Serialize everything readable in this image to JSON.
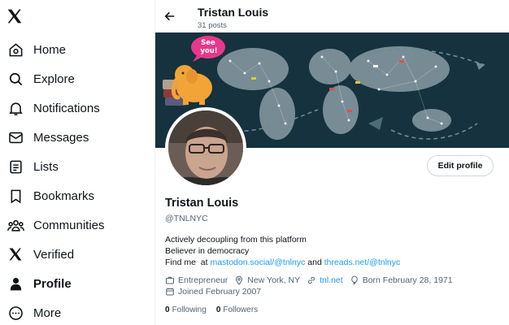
{
  "nav": {
    "logo_icon": "x-logo-icon",
    "items": [
      {
        "label": "Home",
        "icon": "home-icon"
      },
      {
        "label": "Explore",
        "icon": "search-icon"
      },
      {
        "label": "Notifications",
        "icon": "bell-icon"
      },
      {
        "label": "Messages",
        "icon": "envelope-icon"
      },
      {
        "label": "Lists",
        "icon": "list-icon"
      },
      {
        "label": "Bookmarks",
        "icon": "bookmark-icon"
      },
      {
        "label": "Communities",
        "icon": "communities-icon"
      },
      {
        "label": "Verified",
        "icon": "x-logo-icon"
      },
      {
        "label": "Profile",
        "icon": "person-icon",
        "active": true
      },
      {
        "label": "More",
        "icon": "more-circle-icon"
      }
    ]
  },
  "header": {
    "name": "Tristan Louis",
    "posts": "31 posts"
  },
  "banner": {
    "sticker_text_1": "See",
    "sticker_text_2": "you!"
  },
  "profile": {
    "edit_label": "Edit profile",
    "name": "Tristan Louis",
    "handle": "@TNLNYC",
    "bio_line1": "Actively decoupling from this platform",
    "bio_line2": "Believer in democracy",
    "bio_line3_prefix": "Find me  at ",
    "bio_link1": "mastodon.social/@tnlnyc",
    "bio_and": " and ",
    "bio_link2": "threads.net/@tnlnyc",
    "category": "Entrepreneur",
    "location": "New York, NY",
    "website": "tnl.net",
    "born": "Born February 28, 1971",
    "joined": "Joined February 2007",
    "following_count": "0",
    "following_label": "Following",
    "followers_count": "0",
    "followers_label": "Followers"
  },
  "colors": {
    "link": "#1d9bf0",
    "secondary_text": "#536471",
    "banner_bg": "#16323e",
    "sticker_pink": "#e8378c",
    "elephant_orange": "#f2a436"
  }
}
